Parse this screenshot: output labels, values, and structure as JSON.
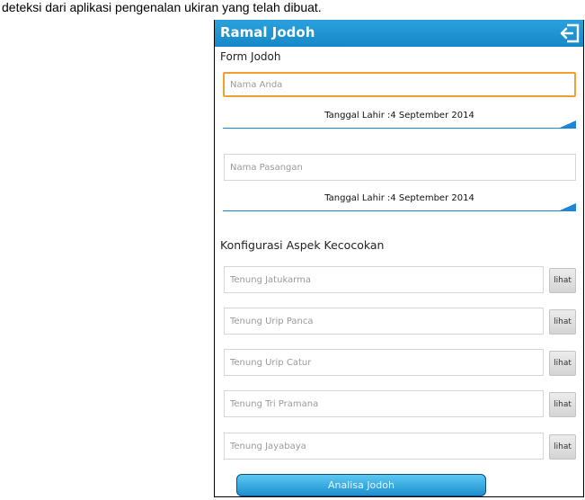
{
  "caption": "deteksi dari aplikasi pengenalan ukiran yang telah dibuat.",
  "app": {
    "title": "Ramal Jodoh",
    "exit_icon": "exit-arrow-icon",
    "accent_color": "#1b86d6"
  },
  "form": {
    "heading": "Form Jodoh",
    "name_field": {
      "placeholder": "Nama Anda",
      "value": ""
    },
    "birth_date_1": "Tanggal Lahir :4 September 2014",
    "partner_field": {
      "placeholder": "Nama Pasangan",
      "value": ""
    },
    "birth_date_2": "Tanggal Lahir :4 September 2014"
  },
  "config": {
    "heading": "Konfigurasi Aspek Kecocokan",
    "aspects": [
      {
        "placeholder": "Tenung Jatukarma",
        "button": "lihat"
      },
      {
        "placeholder": "Tenung Urip Panca",
        "button": "lihat"
      },
      {
        "placeholder": "Tenung Urip Catur",
        "button": "lihat"
      },
      {
        "placeholder": "Tenung Tri Pramana",
        "button": "lihat"
      },
      {
        "placeholder": "Tenung Jayabaya",
        "button": "lihat"
      }
    ]
  },
  "actions": {
    "analyze_label": "Analisa Jodoh"
  }
}
